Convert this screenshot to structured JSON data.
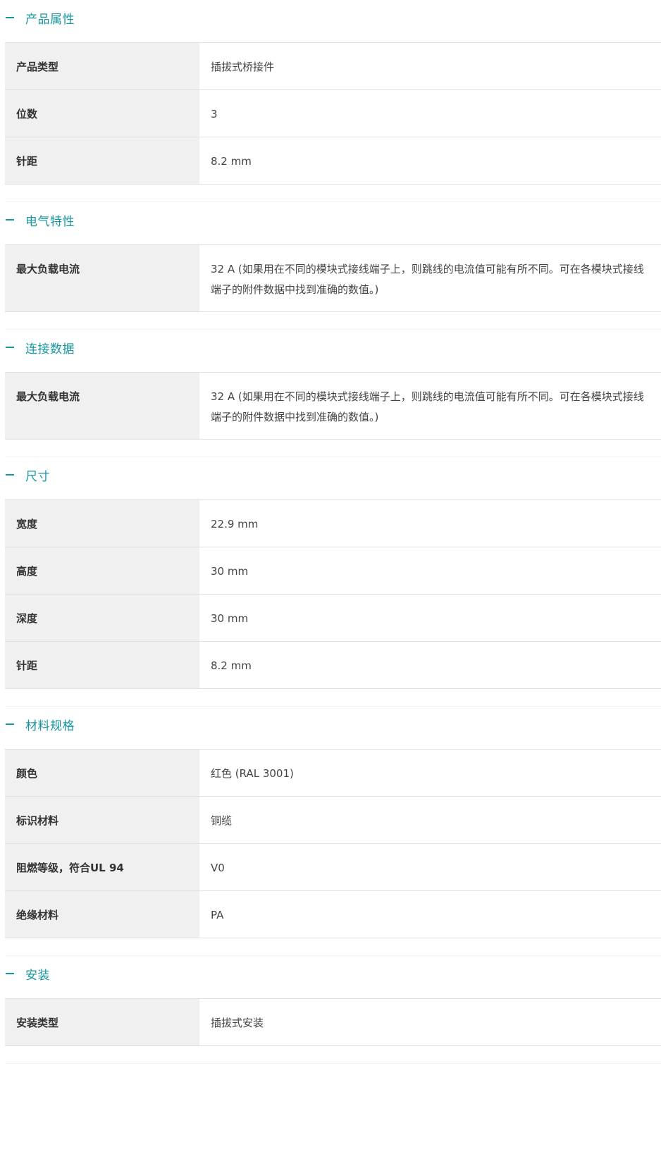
{
  "sections": [
    {
      "title": "产品属性",
      "rows": [
        {
          "label": "产品类型",
          "value": "插拔式桥接件"
        },
        {
          "label": "位数",
          "value": "3"
        },
        {
          "label": "针距",
          "value": "8.2 mm"
        }
      ]
    },
    {
      "title": "电气特性",
      "rows": [
        {
          "label": "最大负载电流",
          "value": "32 A (如果用在不同的模块式接线端子上，则跳线的电流值可能有所不同。可在各模块式接线端子的附件数据中找到准确的数值。)"
        }
      ]
    },
    {
      "title": "连接数据",
      "rows": [
        {
          "label": "最大负载电流",
          "value": "32 A (如果用在不同的模块式接线端子上，则跳线的电流值可能有所不同。可在各模块式接线端子的附件数据中找到准确的数值。)"
        }
      ]
    },
    {
      "title": "尺寸",
      "rows": [
        {
          "label": "宽度",
          "value": "22.9 mm"
        },
        {
          "label": "高度",
          "value": "30 mm"
        },
        {
          "label": "深度",
          "value": "30 mm"
        },
        {
          "label": "针距",
          "value": "8.2 mm"
        }
      ]
    },
    {
      "title": "材料规格",
      "rows": [
        {
          "label": "颜色",
          "value": "红色 (RAL 3001)"
        },
        {
          "label": "标识材料",
          "value": "铜缆"
        },
        {
          "label": "阻燃等级，符合UL 94",
          "value": "V0"
        },
        {
          "label": "绝缘材料",
          "value": "PA"
        }
      ]
    },
    {
      "title": "安装",
      "rows": [
        {
          "label": "安装类型",
          "value": "插拔式安装"
        }
      ]
    }
  ],
  "icons": {
    "section_toggle": "minus-icon"
  },
  "colors": {
    "accent": "#1797a0",
    "label_background": "#f0f0f0",
    "row_border": "#e0e0e0"
  }
}
